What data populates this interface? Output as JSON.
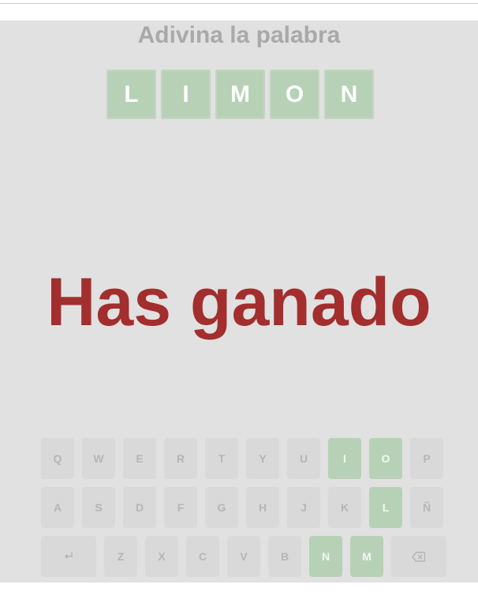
{
  "title": "Adivina la palabra",
  "board": {
    "letters": [
      "L",
      "I",
      "M",
      "O",
      "N"
    ],
    "status_color": "#b7d1b6"
  },
  "result_message": "Has ganado",
  "result_color": "#a32e2e",
  "keyboard": {
    "row1": [
      {
        "label": "Q",
        "state": "unused"
      },
      {
        "label": "W",
        "state": "unused"
      },
      {
        "label": "E",
        "state": "unused"
      },
      {
        "label": "R",
        "state": "unused"
      },
      {
        "label": "T",
        "state": "unused"
      },
      {
        "label": "Y",
        "state": "unused"
      },
      {
        "label": "U",
        "state": "unused"
      },
      {
        "label": "I",
        "state": "correct"
      },
      {
        "label": "O",
        "state": "correct"
      },
      {
        "label": "P",
        "state": "unused"
      }
    ],
    "row2": [
      {
        "label": "A",
        "state": "unused"
      },
      {
        "label": "S",
        "state": "unused"
      },
      {
        "label": "D",
        "state": "unused"
      },
      {
        "label": "F",
        "state": "unused"
      },
      {
        "label": "G",
        "state": "unused"
      },
      {
        "label": "H",
        "state": "unused"
      },
      {
        "label": "J",
        "state": "unused"
      },
      {
        "label": "K",
        "state": "unused"
      },
      {
        "label": "L",
        "state": "correct"
      },
      {
        "label": "Ñ",
        "state": "unused"
      }
    ],
    "row3": [
      {
        "label": "Z",
        "state": "unused"
      },
      {
        "label": "X",
        "state": "unused"
      },
      {
        "label": "C",
        "state": "unused"
      },
      {
        "label": "V",
        "state": "unused"
      },
      {
        "label": "B",
        "state": "unused"
      },
      {
        "label": "N",
        "state": "correct"
      },
      {
        "label": "M",
        "state": "correct"
      }
    ],
    "enter_icon": "enter-icon",
    "backspace_icon": "backspace-icon"
  }
}
